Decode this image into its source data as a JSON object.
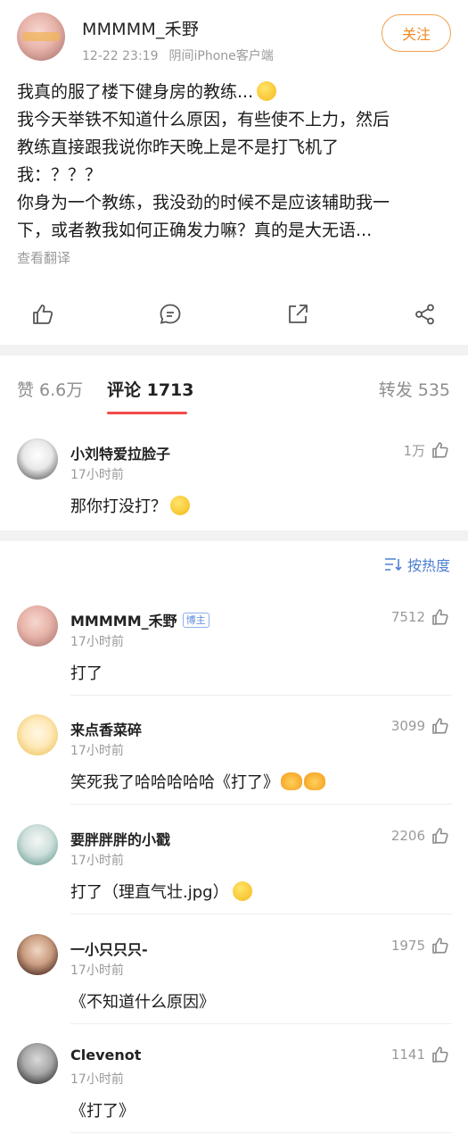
{
  "post": {
    "author": "MMMMM_禾野",
    "time": "12-22 23:19",
    "source": "阴间iPhone客户端",
    "follow_label": "关注",
    "lines": [
      "我真的服了楼下健身房的教练...",
      "我今天举铁不知道什么原因，有些使不上力，然后",
      "教练直接跟我说你昨天晚上是不是打飞机了",
      "我：？？？",
      "你身为一个教练，我没劲的时候不是应该辅助我一",
      "下，或者教我如何正确发力嘛？真的是大无语..."
    ],
    "translate_label": "查看翻译"
  },
  "actions": {
    "icons": [
      "thumb-up-icon",
      "comment-icon",
      "repost-icon",
      "share-icon"
    ]
  },
  "tabs": {
    "likes": "赞 6.6万",
    "comments": "评论 1713",
    "reposts": "转发 535"
  },
  "hot_comment": {
    "name": "小刘特爱拉脸子",
    "time": "17小时前",
    "text": "那你打没打？",
    "likes": "1万"
  },
  "sort": {
    "label": "按热度"
  },
  "comments": [
    {
      "name": "MMMMM_禾野",
      "badge": "博主",
      "time": "17小时前",
      "text": "打了",
      "likes": "7512"
    },
    {
      "name": "来点香菜碎",
      "time": "17小时前",
      "text": "笑死我了哈哈哈哈哈《打了》",
      "likes": "3099"
    },
    {
      "name": "要胖胖胖的小戳",
      "time": "17小时前",
      "text": "打了（理直气壮.jpg）",
      "likes": "2206"
    },
    {
      "name": "一小只只只-",
      "time": "17小时前",
      "text": "《不知道什么原因》",
      "likes": "1975"
    },
    {
      "name": "Clevenot",
      "time": "17小时前",
      "text": "《打了》",
      "likes": "1141"
    }
  ],
  "colors": {
    "accent_orange": "#f08a24",
    "tab_underline": "#f24a4a",
    "link_blue": "#4f7fd0"
  }
}
